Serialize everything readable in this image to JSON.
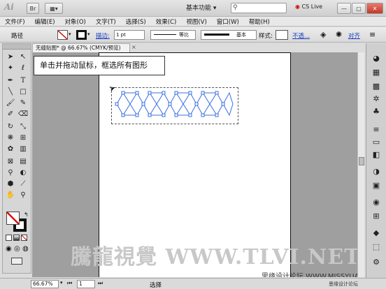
{
  "app": {
    "logo": "Ai",
    "workspace": "基本功能",
    "cs_live": "CS Live",
    "bridge_label": "Br"
  },
  "menus": [
    "文件(F)",
    "编辑(E)",
    "对象(O)",
    "文字(T)",
    "选择(S)",
    "效果(C)",
    "视图(V)",
    "窗口(W)",
    "帮助(H)"
  ],
  "control": {
    "selection_type": "路径",
    "stroke_label": "描边:",
    "stroke_weight": "1 pt",
    "profile": "等比",
    "brush": "基本",
    "style_label": "样式:",
    "opacity_link": "不透...",
    "align_link": "对齐"
  },
  "document": {
    "tab_title": "无缝贴图* @ 66.67% (CMYK/预览)",
    "close": "×"
  },
  "canvas": {
    "callout": "单击并拖动鼠标，框选所有图形",
    "watermark": "騰龍視覺 WWW.TLVI.NET",
    "watermark2": "思缘设计论坛 WWW.MISSYUAN.COM"
  },
  "status": {
    "zoom": "66.67%",
    "page": "1",
    "tool_status": "选择",
    "site": "思缘设计论坛"
  },
  "colors": {
    "path_stroke": "#3a6fe0",
    "accent_red": "#e00000"
  },
  "icons": {
    "tools": [
      "selection-icon",
      "direct-selection-icon",
      "magic-wand-icon",
      "lasso-icon",
      "pen-icon",
      "type-icon",
      "line-icon",
      "rectangle-icon",
      "paintbrush-icon",
      "pencil-icon",
      "blob-brush-icon",
      "eraser-icon",
      "rotate-icon",
      "scale-icon",
      "warp-icon",
      "free-transform-icon",
      "symbol-sprayer-icon",
      "column-graph-icon",
      "mesh-icon",
      "gradient-icon",
      "eyedropper-icon",
      "blend-icon",
      "live-paint-icon",
      "slice-icon",
      "hand-icon",
      "zoom-icon"
    ],
    "right_panel": [
      "color-icon",
      "color-guide-icon",
      "swatches-icon",
      "brushes-icon",
      "symbols-icon",
      "stroke-icon",
      "gradient-panel-icon",
      "transparency-icon",
      "appearance-icon",
      "graphic-styles-icon",
      "layers-icon",
      "artboards-icon"
    ]
  }
}
